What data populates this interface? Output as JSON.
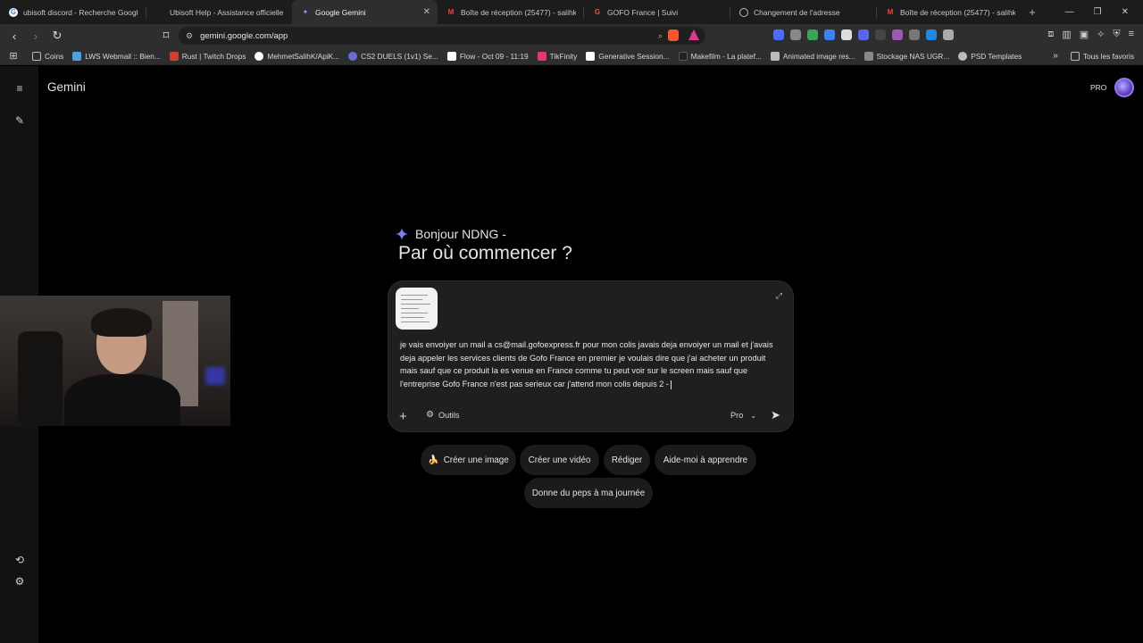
{
  "tabs": [
    {
      "title": "ubisoft discord - Recherche Google",
      "icon": "google-icon",
      "active": false
    },
    {
      "title": "Ubisoft Help - Assistance officielle c",
      "icon": "ubisoft-icon",
      "active": false
    },
    {
      "title": "Google Gemini",
      "icon": "gemini-icon",
      "active": true
    },
    {
      "title": "Boîte de réception (25477) - salihke",
      "icon": "gmail-icon",
      "active": false
    },
    {
      "title": "GOFO France | Suivi",
      "icon": "gofo-icon",
      "active": false
    },
    {
      "title": "Changement de l'adresse",
      "icon": "globe-icon",
      "active": false
    },
    {
      "title": "Boîte de réception (25477) - salihke",
      "icon": "gmail-icon",
      "active": false
    }
  ],
  "address": {
    "url": "gemini.google.com/app"
  },
  "bookmarks": [
    {
      "label": "Coins",
      "color": "#9a9a9a"
    },
    {
      "label": "LWS Webmail :: Bien...",
      "color": "#4aa3df"
    },
    {
      "label": "Rust | Twitch Drops",
      "color": "#cd412b"
    },
    {
      "label": "MehmetSalihK/ApiK...",
      "color": "#ffffff"
    },
    {
      "label": "CS2 DUELS (1v1) Se...",
      "color": "#6b6bd6"
    },
    {
      "label": "Flow - Oct 09 - 11:19",
      "color": "#ffffff"
    },
    {
      "label": "TikFinity",
      "color": "#e8396b"
    },
    {
      "label": "Generative Session...",
      "color": "#ffffff"
    },
    {
      "label": "Makefilm - La platef...",
      "color": "#222222"
    },
    {
      "label": "Animated image res...",
      "color": "#bbbbbb"
    },
    {
      "label": "Stockage NAS UGR...",
      "color": "#888888"
    },
    {
      "label": "PSD Templates",
      "color": "#bbbbbb"
    }
  ],
  "bookmarks_all": "Tous les favoris",
  "app": {
    "brand": "Gemini",
    "pro_badge": "PRO",
    "greeting": "Bonjour NDNG -",
    "headline": "Par où commencer ?",
    "prompt_text": "je vais envoiyer un mail a cs@mail.gofoexpress.fr pour mon colis javais deja envoiyer un mail et j'avais deja appeler les services clients de Gofo France en premier je voulais dire que j'ai acheter un produit mais sauf que ce produit la es venue en France comme tu peut voir sur le screen mais sauf que l'entreprise Gofo France n'est pas serieux car j'attend mon colis depuis 2 -",
    "tools_label": "Outils",
    "model_label": "Pro",
    "chips": [
      {
        "label": "Créer une image",
        "icon": "🍌"
      },
      {
        "label": "Créer une vidéo",
        "icon": ""
      },
      {
        "label": "Rédiger",
        "icon": ""
      },
      {
        "label": "Aide-moi à apprendre",
        "icon": ""
      },
      {
        "label": "Donne du peps à ma journée",
        "icon": ""
      }
    ]
  },
  "colors": {
    "background": "#000000",
    "composer": "#1e1f20",
    "chip": "#1b1b1b",
    "rail": "#121212",
    "text": "#e3e3e3"
  }
}
